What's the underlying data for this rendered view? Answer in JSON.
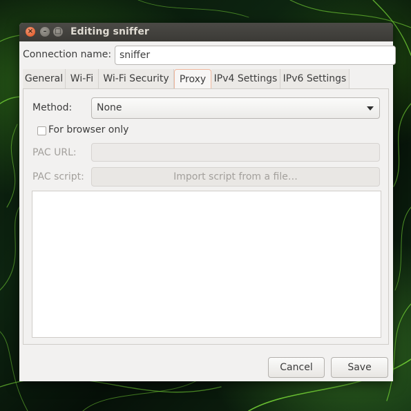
{
  "window": {
    "title": "Editing sniffer",
    "controls": {
      "close": "×",
      "minimize": "–",
      "maximize": "□"
    }
  },
  "connection": {
    "label": "Connection name:",
    "value": "sniffer"
  },
  "tabs": [
    {
      "label": "General",
      "active": false
    },
    {
      "label": "Wi-Fi",
      "active": false
    },
    {
      "label": "Wi-Fi Security",
      "active": false
    },
    {
      "label": "Proxy",
      "active": true
    },
    {
      "label": "IPv4 Settings",
      "active": false
    },
    {
      "label": "IPv6 Settings",
      "active": false
    }
  ],
  "proxy": {
    "method_label": "Method:",
    "method_value": "None",
    "browser_only_label": "For browser only",
    "browser_only_checked": false,
    "pac_url_label": "PAC URL:",
    "pac_url_value": "",
    "pac_script_label": "PAC script:",
    "import_button_label": "Import script from a file…",
    "script_text": ""
  },
  "buttons": {
    "cancel": "Cancel",
    "save": "Save"
  },
  "colors": {
    "titlebar": "#3c3b37",
    "close_button": "#df4b16",
    "active_tab_border": "#f0b79d",
    "window_background": "#f2f1f0",
    "wallpaper_accent": "#5fd02a"
  }
}
